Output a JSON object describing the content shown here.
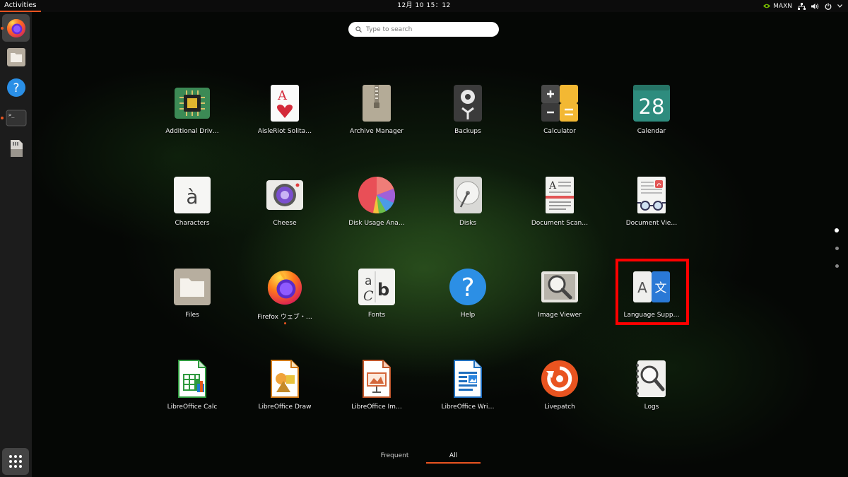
{
  "topbar": {
    "activities_label": "Activities",
    "clock": "12月 10 15：12",
    "power_mode": "MAXN",
    "icons": [
      "nvidia-icon",
      "network-icon",
      "volume-icon",
      "power-icon",
      "chevron-down-icon"
    ]
  },
  "dock": {
    "items": [
      {
        "name": "Firefox",
        "icon": "firefox-icon",
        "active": true,
        "running": true
      },
      {
        "name": "Files",
        "icon": "files-icon",
        "active": false,
        "running": false
      },
      {
        "name": "Help",
        "icon": "help-icon",
        "active": false,
        "running": false
      },
      {
        "name": "Terminal",
        "icon": "terminal-icon",
        "active": false,
        "running": true
      },
      {
        "name": "SD Card",
        "icon": "sdcard-icon",
        "active": false,
        "running": false
      }
    ],
    "show_apps_icon": "grid-icon"
  },
  "search": {
    "placeholder": "Type to search",
    "value": ""
  },
  "apps": [
    {
      "label": "Additional Driv…",
      "icon": "chip-icon"
    },
    {
      "label": "AisleRiot Solita…",
      "icon": "cards-icon"
    },
    {
      "label": "Archive Manager",
      "icon": "archive-icon"
    },
    {
      "label": "Backups",
      "icon": "backup-icon"
    },
    {
      "label": "Calculator",
      "icon": "calculator-icon"
    },
    {
      "label": "Calendar",
      "icon": "calendar-icon",
      "day": "28"
    },
    {
      "label": "Characters",
      "icon": "characters-icon",
      "glyph": "à"
    },
    {
      "label": "Cheese",
      "icon": "camera-icon"
    },
    {
      "label": "Disk Usage Ana…",
      "icon": "pie-icon"
    },
    {
      "label": "Disks",
      "icon": "disk-icon"
    },
    {
      "label": "Document Scan…",
      "icon": "scanner-icon"
    },
    {
      "label": "Document Vie…",
      "icon": "document-viewer-icon"
    },
    {
      "label": "Files",
      "icon": "folder-icon"
    },
    {
      "label": "Firefox ウェブ・…",
      "icon": "firefox-icon",
      "running": true
    },
    {
      "label": "Fonts",
      "icon": "fonts-icon"
    },
    {
      "label": "Help",
      "icon": "help-icon"
    },
    {
      "label": "Image Viewer",
      "icon": "image-viewer-icon"
    },
    {
      "label": "Language Supp…",
      "icon": "language-icon",
      "highlighted": true
    },
    {
      "label": "LibreOffice Calc",
      "icon": "calc-icon"
    },
    {
      "label": "LibreOffice Draw",
      "icon": "draw-icon"
    },
    {
      "label": "LibreOffice Im…",
      "icon": "impress-icon"
    },
    {
      "label": "LibreOffice Wri…",
      "icon": "writer-icon"
    },
    {
      "label": "Livepatch",
      "icon": "livepatch-icon"
    },
    {
      "label": "Logs",
      "icon": "logs-icon"
    }
  ],
  "pages": {
    "count": 3,
    "current": 1
  },
  "tabs": [
    {
      "label": "Frequent",
      "selected": false
    },
    {
      "label": "All",
      "selected": true
    }
  ],
  "colors": {
    "accent": "#e95420",
    "highlight": "#ff0000",
    "topbar": "#0c0c0c"
  }
}
